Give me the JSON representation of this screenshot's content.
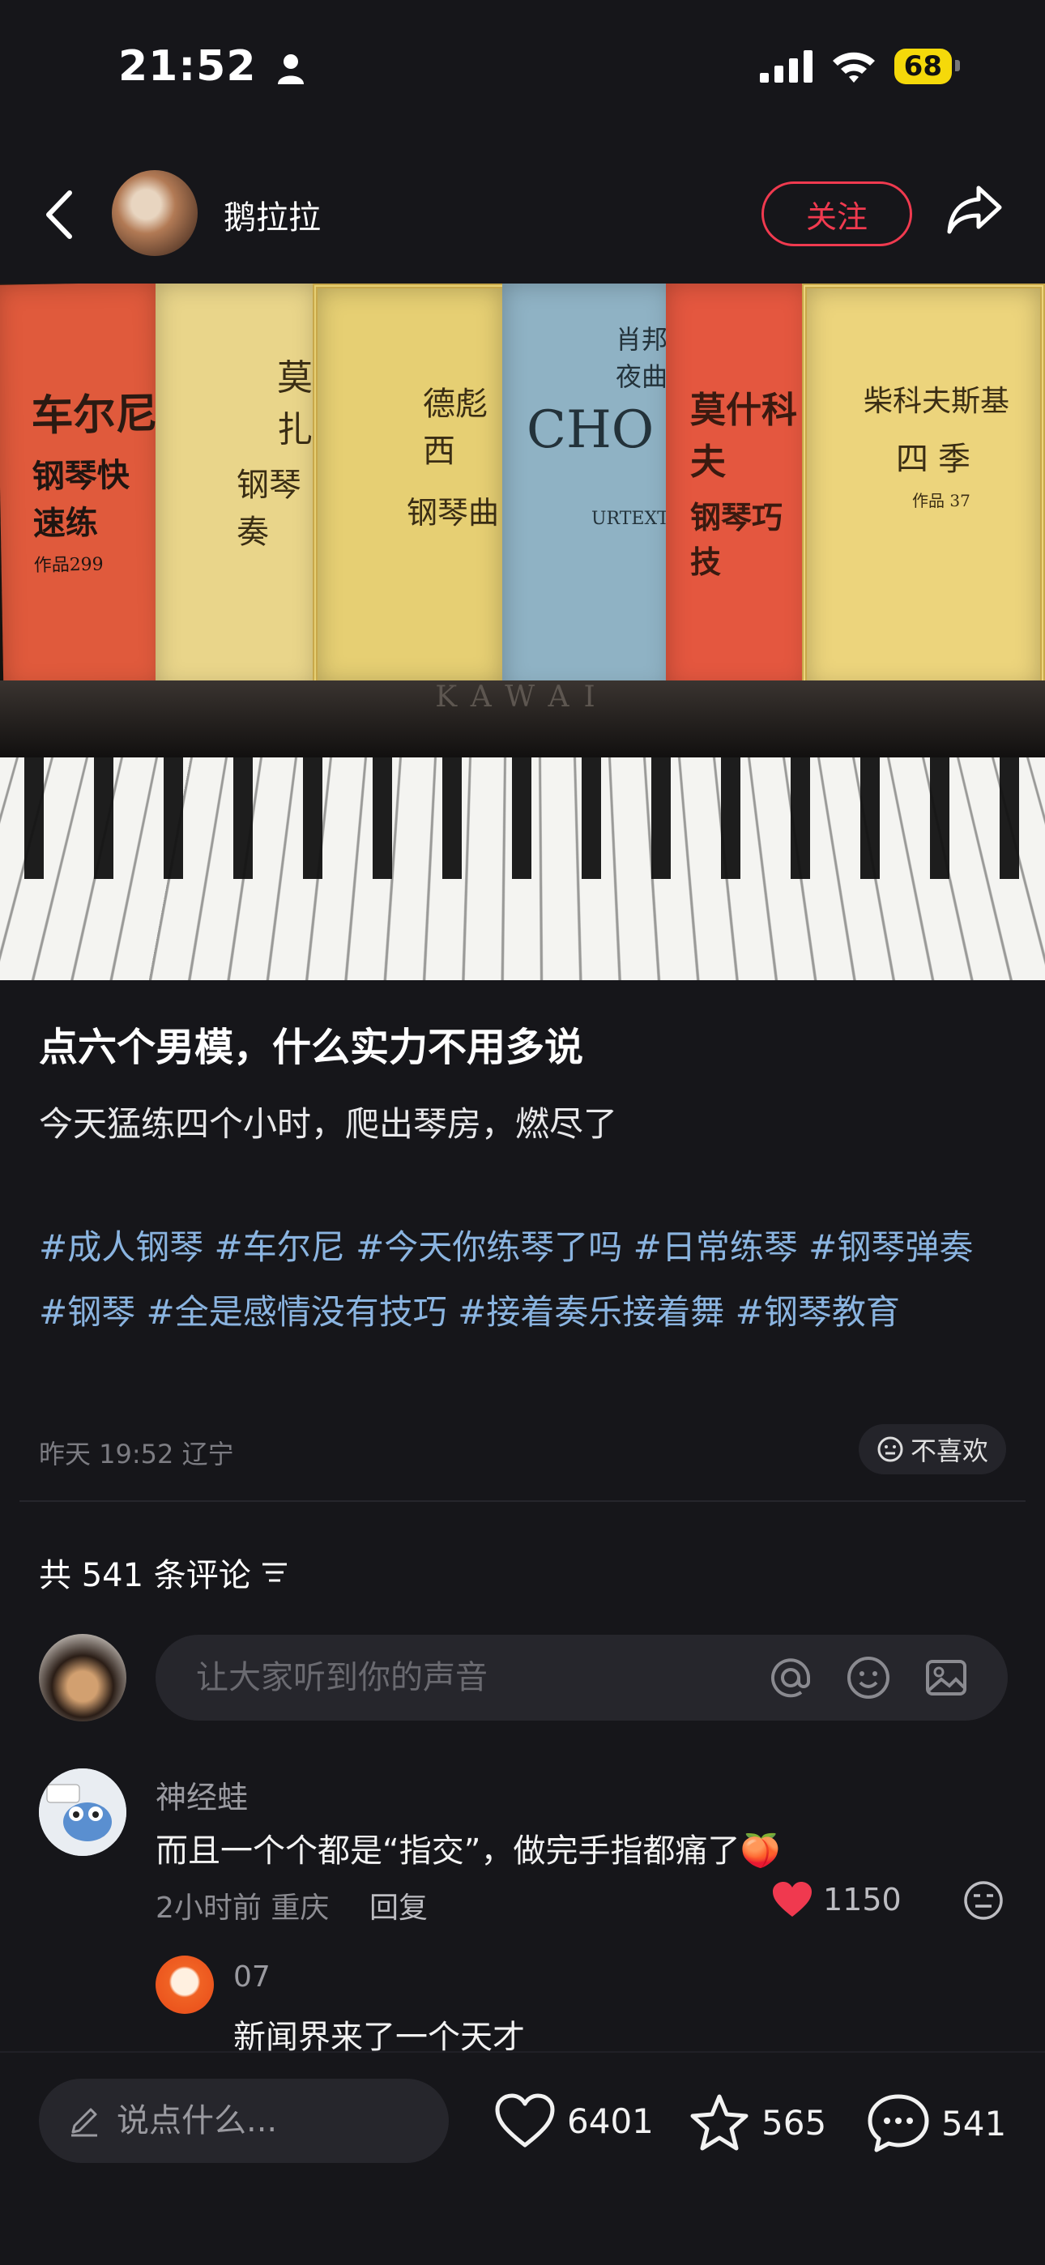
{
  "status_bar": {
    "time": "21:52",
    "battery": "68"
  },
  "header": {
    "author_name": "鹅拉拉",
    "follow_label": "关注"
  },
  "hero": {
    "books": [
      {
        "title": "车尔尼",
        "subtitle": "钢琴快速练",
        "extra": "作品299",
        "color": "#e05a3c"
      },
      {
        "title": "莫扎",
        "subtitle": "钢琴奏",
        "extra": "",
        "color": "#e9d58a"
      },
      {
        "title": "德彪西",
        "subtitle": "钢琴曲",
        "extra": "",
        "color": "#e6cf73"
      },
      {
        "title": "CHO",
        "subtitle": "肖邦 夜曲",
        "extra": "URTEXT",
        "color": "#8fb2c4"
      },
      {
        "title": "莫什科夫",
        "subtitle": "钢琴巧技",
        "extra": "",
        "color": "#e4573f"
      },
      {
        "title": "柴科夫斯基",
        "subtitle": "四季",
        "extra": "作品 37",
        "color": "#ecd47c"
      }
    ],
    "piano_brand": "KAWAI"
  },
  "post": {
    "title": "点六个男模，什么实力不用多说",
    "body": "今天猛练四个小时，爬出琴房，燃尽了",
    "hashtags": "#成人钢琴 #车尔尼 #今天你练琴了吗 #日常练琴 #钢琴弹奏 #钢琴 #全是感情没有技巧 #接着奏乐接着舞 #钢琴教育",
    "meta": "昨天 19:52 辽宁",
    "dislike_label": "不喜欢"
  },
  "comments_section": {
    "count_label": "共 541 条评论",
    "input_placeholder": "让大家听到你的声音"
  },
  "comments": [
    {
      "user": "神经蛙",
      "text": "而且一个个都是“指交”，做完手指都痛了🍑",
      "meta": "2小时前 重庆",
      "reply_label": "回复",
      "likes": "1150",
      "replies": [
        {
          "user": "07",
          "text": "新闻界来了一个天才"
        }
      ]
    }
  ],
  "bottom_bar": {
    "say_placeholder": "说点什么...",
    "likes": "6401",
    "favorites": "565",
    "comments": "541"
  },
  "colors": {
    "accent": "#f03a4f",
    "hashtag": "#8ab4e0",
    "background": "#16161a"
  }
}
